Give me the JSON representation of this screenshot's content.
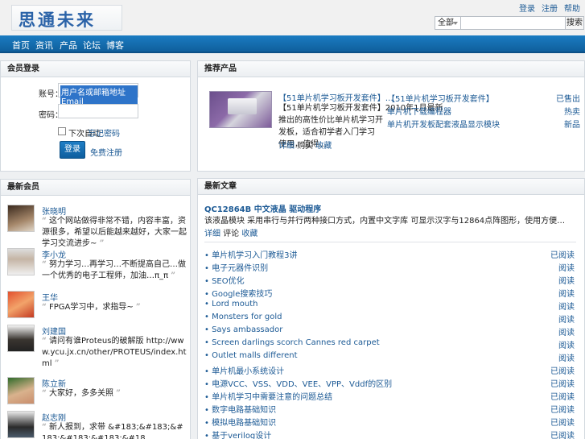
{
  "logo": {
    "text": "思通未来"
  },
  "toplinks": [
    "登录",
    "注册",
    "帮助"
  ],
  "search": {
    "scope": "全部",
    "placeholder": "",
    "button": "搜索"
  },
  "nav": [
    "首页",
    "资讯",
    "产品",
    "论坛",
    "博客"
  ],
  "login": {
    "title": "会员登录",
    "user_label": "账号：",
    "user_value": "用户名或邮箱地址Email",
    "pass_label": "密码：",
    "remember": "下次自动",
    "forgot": "忘记密码",
    "submit": "登录",
    "register": "免费注册"
  },
  "users": {
    "title": "最新会员",
    "items": [
      {
        "name": "张晓明",
        "text": "这个网站做得非常不错，内容丰富，资源很多，希望以后能越来越好，大家一起学习交流进步~"
      },
      {
        "name": "李小龙",
        "text": "努力学习…再学习…不断提高自己…做一个优秀的电子工程师，加油…π_π"
      },
      {
        "name": "王华",
        "text": "FPGA学习中，求指导~"
      },
      {
        "name": "刘建国",
        "text": "请问有谁Proteus的破解版 http://www.ycu.jx.cn/other/PROTEUS/index.html"
      },
      {
        "name": "陈立新",
        "text": "大家好，多多关照"
      },
      {
        "name": "赵志刚",
        "text": "新人报到，求带 &#183;&#183;&#183;&#183;&#183;&#18"
      }
    ]
  },
  "products": {
    "title": "推荐产品",
    "featured_title": "【51单片机学习板开发套件】…",
    "featured_desc_1": "【51单片机学习板开发套件】2010年1月最新",
    "featured_desc_2": "推出的高性价比单片机学习开发板，适合初学者入门学习",
    "featured_desc_3": "使用，值得…",
    "featured_links": [
      "详细",
      "购买",
      "收藏"
    ],
    "list": [
      {
        "title": "【51单片机学习板开发套件】",
        "count": "已售出"
      },
      {
        "title": "单片机下载编程器",
        "count": "热卖"
      },
      {
        "title": "单片机开发板配套液晶显示模块",
        "count": "新品"
      }
    ]
  },
  "articles": {
    "title": "最新文章",
    "headline": "QC12864B 中文液晶 驱动程序",
    "summary": "该液晶模块 采用串行与并行两种接口方式，内置中文字库 可显示汉字与12864点阵图形，使用方便…",
    "links": [
      "详细",
      "评论",
      "收藏"
    ],
    "items": [
      {
        "title": "单片机学习入门教程3讲",
        "count": "已阅读"
      },
      {
        "title": "电子元器件识别",
        "count": "阅读"
      },
      {
        "title": "SEO优化",
        "count": "阅读"
      },
      {
        "title": "Google搜索技巧",
        "count": "阅读"
      },
      {
        "title": "Lord mouth",
        "count": "阅读"
      },
      {
        "title": "Monsters for gold",
        "count": "阅读"
      },
      {
        "title": "Says ambassador",
        "count": "阅读"
      },
      {
        "title": "Screen darlings scorch Cannes red carpet",
        "count": "阅读"
      },
      {
        "title": "Outlet malls different",
        "count": "阅读"
      },
      {
        "title": "单片机最小系统设计",
        "count": "已阅读"
      },
      {
        "title": "电源VCC、VSS、VDD、VEE、VPP、Vddf的区别",
        "count": "已阅读"
      },
      {
        "title": "单片机学习中需要注意的问题总结",
        "count": "已阅读"
      },
      {
        "title": "数字电路基础知识",
        "count": "已阅读"
      },
      {
        "title": "模拟电路基础知识",
        "count": "已阅读"
      },
      {
        "title": "基于verilog设计",
        "count": "已阅读"
      }
    ]
  }
}
